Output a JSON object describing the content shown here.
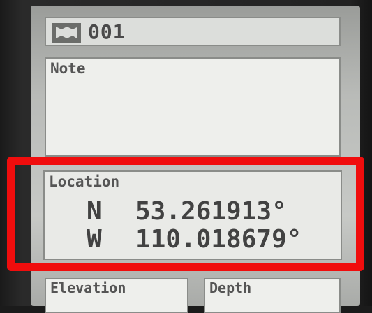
{
  "header": {
    "flag_icon": "flag-icon",
    "waypoint_name": "001"
  },
  "note": {
    "label": "Note",
    "value": ""
  },
  "location": {
    "label": "Location",
    "lat_dir": "N",
    "lat_value": "53.261913°",
    "lon_dir": "W",
    "lon_value": "110.018679°"
  },
  "elevation": {
    "label": "Elevation"
  },
  "depth": {
    "label": "Depth"
  },
  "colors": {
    "highlight": "#f00d0d",
    "screen": "#eeefec",
    "text": "#424242"
  }
}
